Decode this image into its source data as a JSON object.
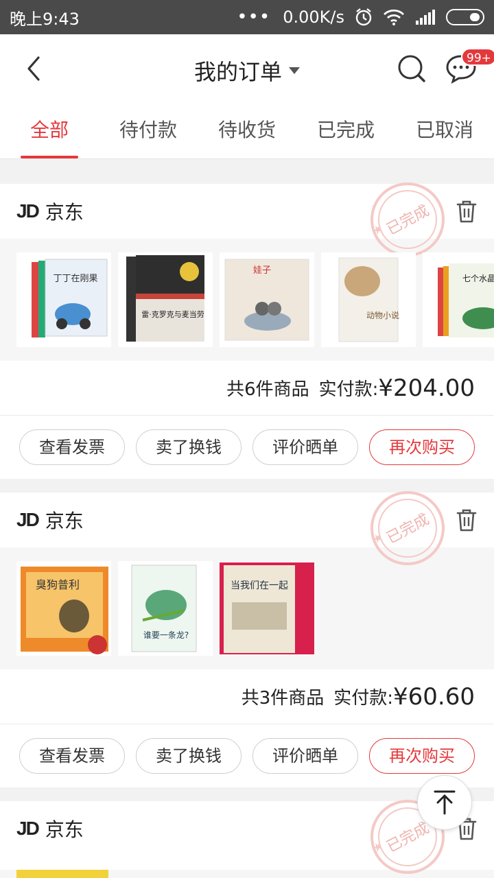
{
  "status_bar": {
    "time": "晚上9:43",
    "dots": "•••",
    "speed": "0.00K/s"
  },
  "header": {
    "title": "我的订单",
    "badge": "99+"
  },
  "tabs": [
    "全部",
    "待付款",
    "待收货",
    "已完成",
    "已取消"
  ],
  "active_tab": 0,
  "orders": [
    {
      "shop": "京东",
      "logo": "JD",
      "status_stamp": "已完成",
      "count_text": "共6件商品",
      "paid_label": "实付款:",
      "price": "¥204.00",
      "items": [
        {
          "title": "丁丁在刚果",
          "color": "#4a8fd0"
        },
        {
          "title": "雷·克罗克与麦当劳",
          "color": "#c8443a"
        },
        {
          "title": "娃子",
          "color": "#d9c7b6"
        },
        {
          "title": "动物小说",
          "color": "#c9a77a"
        },
        {
          "title": "七个水晶球",
          "color": "#3f8e4f"
        }
      ]
    },
    {
      "shop": "京东",
      "logo": "JD",
      "status_stamp": "已完成",
      "count_text": "共3件商品",
      "paid_label": "实付款:",
      "price": "¥60.60",
      "items": [
        {
          "title": "臭狗普利",
          "color": "#ee8a2a"
        },
        {
          "title": "谁要一条龙?",
          "color": "#5aa77a"
        },
        {
          "title": "当我们在一起",
          "color": "#d7204c"
        }
      ]
    },
    {
      "shop": "京东",
      "logo": "JD",
      "status_stamp": "已完成"
    }
  ],
  "actions": [
    "查看发票",
    "卖了换钱",
    "评价晒单",
    "再次购买"
  ],
  "colors": {
    "accent": "#e4393c",
    "status_bar": "#4a4a4a"
  },
  "icons": [
    "back-icon",
    "search-icon",
    "message-icon",
    "trash-icon",
    "back-to-top-icon"
  ]
}
